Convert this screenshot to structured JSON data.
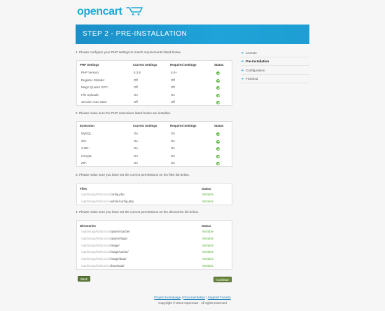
{
  "brand": {
    "logo_text": "opencart"
  },
  "banner": {
    "title": "STEP 2 - PRE-INSTALLATION"
  },
  "sidebar": {
    "items": [
      {
        "label": "License",
        "active": false
      },
      {
        "label": "Pre-Installation",
        "active": true
      },
      {
        "label": "Configuration",
        "active": false
      },
      {
        "label": "Finished",
        "active": false
      }
    ]
  },
  "php_settings": {
    "intro": "1. Please configure your PHP settings to match requirements listed below.",
    "headers": [
      "PHP Settings",
      "Current Settings",
      "Required Settings",
      "Status"
    ],
    "rows": [
      {
        "name": "PHP Version:",
        "current": "5.3.8",
        "required": "5.0+"
      },
      {
        "name": "Register Globals:",
        "current": "Off",
        "required": "Off"
      },
      {
        "name": "Magic Quotes GPC:",
        "current": "Off",
        "required": "Off"
      },
      {
        "name": "File Uploads:",
        "current": "On",
        "required": "On"
      },
      {
        "name": "Session Auto Start:",
        "current": "Off",
        "required": "Off"
      }
    ]
  },
  "extensions": {
    "intro": "2. Please make sure the PHP extensions listed below are installed.",
    "headers": [
      "Extension",
      "Current Settings",
      "Required Settings",
      "Status"
    ],
    "rows": [
      {
        "name": "MySQL:",
        "current": "On",
        "required": "On"
      },
      {
        "name": "GD:",
        "current": "On",
        "required": "On"
      },
      {
        "name": "cURL:",
        "current": "On",
        "required": "On"
      },
      {
        "name": "mCrypt:",
        "current": "On",
        "required": "On"
      },
      {
        "name": "ZIP:",
        "current": "On",
        "required": "On"
      }
    ]
  },
  "files": {
    "intro": "3. Please make sure you have set the correct permissions on the files list below.",
    "headers": [
      "Files",
      "Status"
    ],
    "rows": [
      {
        "prefix": "/opt/lampp/htdocs/cs/",
        "suffix": "config.php",
        "status": "Writable"
      },
      {
        "prefix": "/opt/lampp/htdocs/cs/",
        "suffix": "admin/config.php",
        "status": "Writable"
      }
    ]
  },
  "directories": {
    "intro": "4. Please make sure you have set the correct permissions on the directories list below.",
    "headers": [
      "Directories",
      "Status"
    ],
    "rows": [
      {
        "prefix": "/opt/lampp/htdocs/cs/",
        "suffix": "system/cache/",
        "status": "Writable"
      },
      {
        "prefix": "/opt/lampp/htdocs/cs/",
        "suffix": "system/logs/",
        "status": "Writable"
      },
      {
        "prefix": "/opt/lampp/htdocs/cs/",
        "suffix": "image/",
        "status": "Writable"
      },
      {
        "prefix": "/opt/lampp/htdocs/cs/",
        "suffix": "image/cache/",
        "status": "Writable"
      },
      {
        "prefix": "/opt/lampp/htdocs/cs/",
        "suffix": "image/data/",
        "status": "Writable"
      },
      {
        "prefix": "/opt/lampp/htdocs/cs/",
        "suffix": "download/",
        "status": "Writable"
      }
    ]
  },
  "buttons": {
    "back": "Back",
    "continue": "Continue"
  },
  "footer": {
    "links": [
      "Project Homepage",
      "Documentation",
      "Support Forums"
    ],
    "separator": " | ",
    "copyright": "Copyright © 2012 OpenCart - All rights reserved"
  },
  "colors": {
    "accent": "#1ea9d8",
    "ok": "#5db342",
    "button": "#6a8a3c"
  }
}
